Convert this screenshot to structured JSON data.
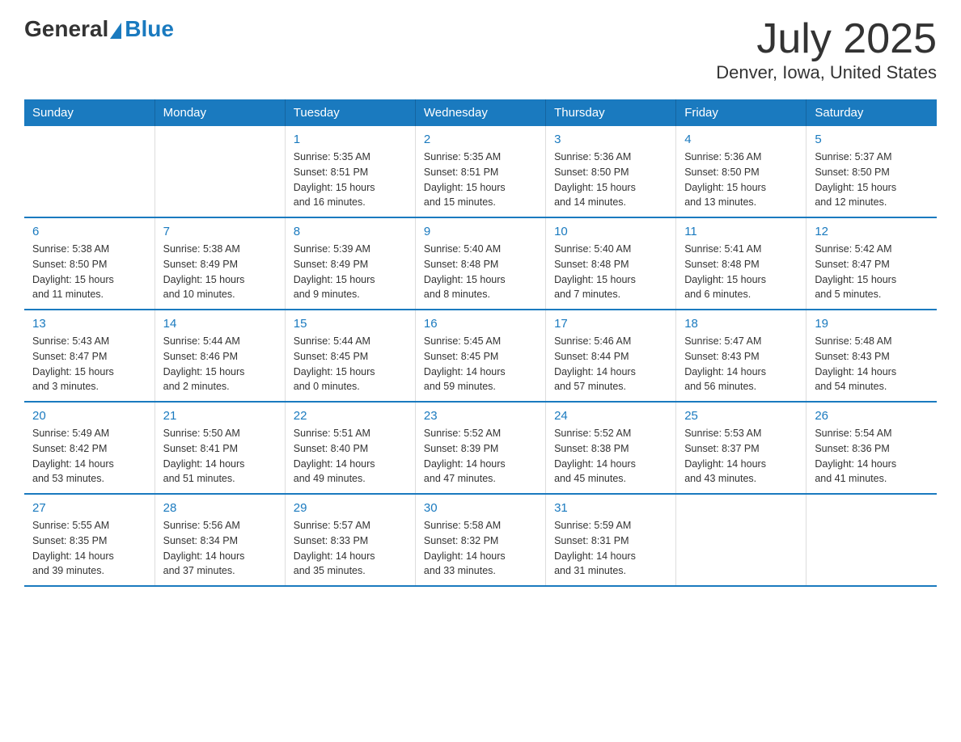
{
  "logo": {
    "general": "General",
    "blue": "Blue"
  },
  "title": "July 2025",
  "location": "Denver, Iowa, United States",
  "days_of_week": [
    "Sunday",
    "Monday",
    "Tuesday",
    "Wednesday",
    "Thursday",
    "Friday",
    "Saturday"
  ],
  "weeks": [
    [
      {
        "day": "",
        "info": ""
      },
      {
        "day": "",
        "info": ""
      },
      {
        "day": "1",
        "info": "Sunrise: 5:35 AM\nSunset: 8:51 PM\nDaylight: 15 hours\nand 16 minutes."
      },
      {
        "day": "2",
        "info": "Sunrise: 5:35 AM\nSunset: 8:51 PM\nDaylight: 15 hours\nand 15 minutes."
      },
      {
        "day": "3",
        "info": "Sunrise: 5:36 AM\nSunset: 8:50 PM\nDaylight: 15 hours\nand 14 minutes."
      },
      {
        "day": "4",
        "info": "Sunrise: 5:36 AM\nSunset: 8:50 PM\nDaylight: 15 hours\nand 13 minutes."
      },
      {
        "day": "5",
        "info": "Sunrise: 5:37 AM\nSunset: 8:50 PM\nDaylight: 15 hours\nand 12 minutes."
      }
    ],
    [
      {
        "day": "6",
        "info": "Sunrise: 5:38 AM\nSunset: 8:50 PM\nDaylight: 15 hours\nand 11 minutes."
      },
      {
        "day": "7",
        "info": "Sunrise: 5:38 AM\nSunset: 8:49 PM\nDaylight: 15 hours\nand 10 minutes."
      },
      {
        "day": "8",
        "info": "Sunrise: 5:39 AM\nSunset: 8:49 PM\nDaylight: 15 hours\nand 9 minutes."
      },
      {
        "day": "9",
        "info": "Sunrise: 5:40 AM\nSunset: 8:48 PM\nDaylight: 15 hours\nand 8 minutes."
      },
      {
        "day": "10",
        "info": "Sunrise: 5:40 AM\nSunset: 8:48 PM\nDaylight: 15 hours\nand 7 minutes."
      },
      {
        "day": "11",
        "info": "Sunrise: 5:41 AM\nSunset: 8:48 PM\nDaylight: 15 hours\nand 6 minutes."
      },
      {
        "day": "12",
        "info": "Sunrise: 5:42 AM\nSunset: 8:47 PM\nDaylight: 15 hours\nand 5 minutes."
      }
    ],
    [
      {
        "day": "13",
        "info": "Sunrise: 5:43 AM\nSunset: 8:47 PM\nDaylight: 15 hours\nand 3 minutes."
      },
      {
        "day": "14",
        "info": "Sunrise: 5:44 AM\nSunset: 8:46 PM\nDaylight: 15 hours\nand 2 minutes."
      },
      {
        "day": "15",
        "info": "Sunrise: 5:44 AM\nSunset: 8:45 PM\nDaylight: 15 hours\nand 0 minutes."
      },
      {
        "day": "16",
        "info": "Sunrise: 5:45 AM\nSunset: 8:45 PM\nDaylight: 14 hours\nand 59 minutes."
      },
      {
        "day": "17",
        "info": "Sunrise: 5:46 AM\nSunset: 8:44 PM\nDaylight: 14 hours\nand 57 minutes."
      },
      {
        "day": "18",
        "info": "Sunrise: 5:47 AM\nSunset: 8:43 PM\nDaylight: 14 hours\nand 56 minutes."
      },
      {
        "day": "19",
        "info": "Sunrise: 5:48 AM\nSunset: 8:43 PM\nDaylight: 14 hours\nand 54 minutes."
      }
    ],
    [
      {
        "day": "20",
        "info": "Sunrise: 5:49 AM\nSunset: 8:42 PM\nDaylight: 14 hours\nand 53 minutes."
      },
      {
        "day": "21",
        "info": "Sunrise: 5:50 AM\nSunset: 8:41 PM\nDaylight: 14 hours\nand 51 minutes."
      },
      {
        "day": "22",
        "info": "Sunrise: 5:51 AM\nSunset: 8:40 PM\nDaylight: 14 hours\nand 49 minutes."
      },
      {
        "day": "23",
        "info": "Sunrise: 5:52 AM\nSunset: 8:39 PM\nDaylight: 14 hours\nand 47 minutes."
      },
      {
        "day": "24",
        "info": "Sunrise: 5:52 AM\nSunset: 8:38 PM\nDaylight: 14 hours\nand 45 minutes."
      },
      {
        "day": "25",
        "info": "Sunrise: 5:53 AM\nSunset: 8:37 PM\nDaylight: 14 hours\nand 43 minutes."
      },
      {
        "day": "26",
        "info": "Sunrise: 5:54 AM\nSunset: 8:36 PM\nDaylight: 14 hours\nand 41 minutes."
      }
    ],
    [
      {
        "day": "27",
        "info": "Sunrise: 5:55 AM\nSunset: 8:35 PM\nDaylight: 14 hours\nand 39 minutes."
      },
      {
        "day": "28",
        "info": "Sunrise: 5:56 AM\nSunset: 8:34 PM\nDaylight: 14 hours\nand 37 minutes."
      },
      {
        "day": "29",
        "info": "Sunrise: 5:57 AM\nSunset: 8:33 PM\nDaylight: 14 hours\nand 35 minutes."
      },
      {
        "day": "30",
        "info": "Sunrise: 5:58 AM\nSunset: 8:32 PM\nDaylight: 14 hours\nand 33 minutes."
      },
      {
        "day": "31",
        "info": "Sunrise: 5:59 AM\nSunset: 8:31 PM\nDaylight: 14 hours\nand 31 minutes."
      },
      {
        "day": "",
        "info": ""
      },
      {
        "day": "",
        "info": ""
      }
    ]
  ]
}
